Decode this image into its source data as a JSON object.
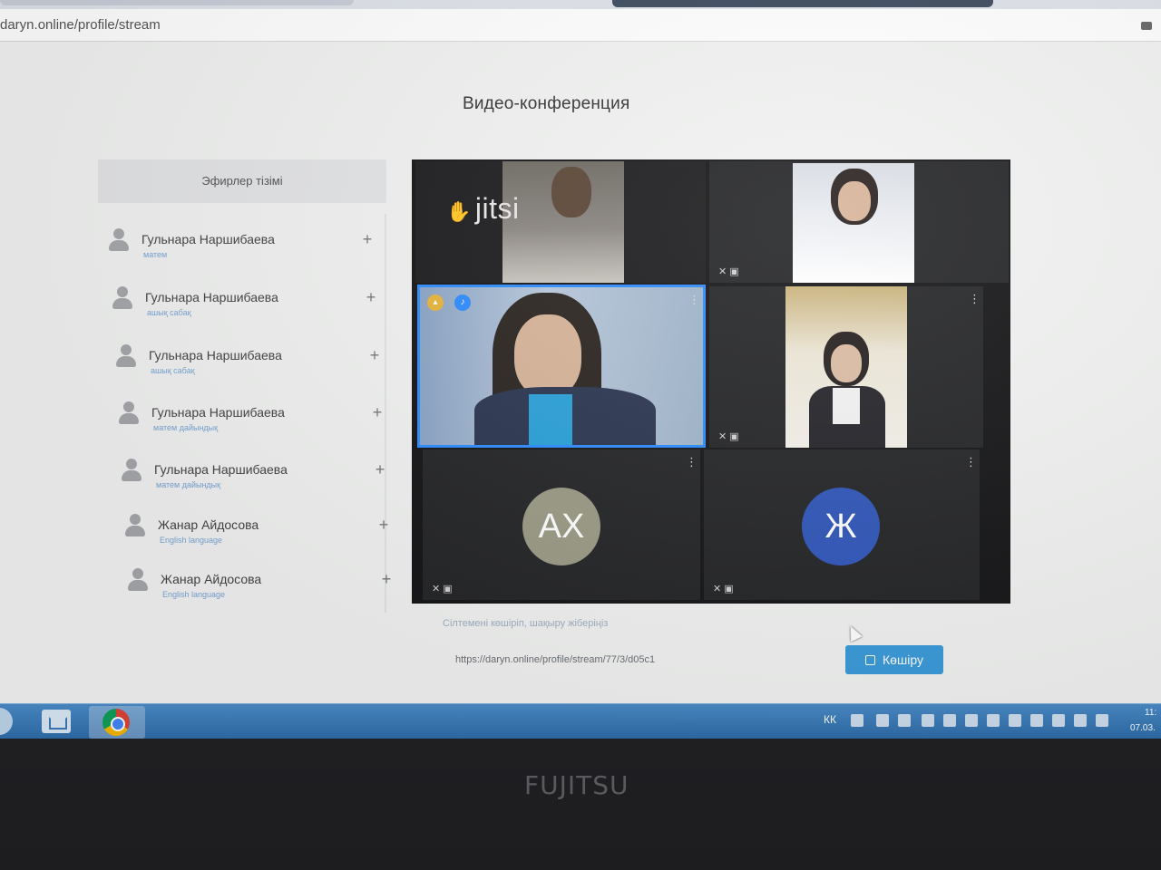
{
  "browser": {
    "url": "daryn.online/profile/stream"
  },
  "page": {
    "title": "Видео-конференция"
  },
  "sidebar": {
    "header": "Эфирлер тізімі",
    "items": [
      {
        "name": "Гульнара Наршибаева",
        "subject": "матем"
      },
      {
        "name": "Гульнара Наршибаева",
        "subject": "ашық сабақ"
      },
      {
        "name": "Гульнара Наршибаева",
        "subject": "ашық сабақ"
      },
      {
        "name": "Гульнара Наршибаева",
        "subject": "матем дайындық"
      },
      {
        "name": "Гульнара Наршибаева",
        "subject": "матем дайындық"
      },
      {
        "name": "Жанар Айдосова",
        "subject": "English language"
      },
      {
        "name": "Жанар Айдосова",
        "subject": "English language"
      }
    ],
    "add_symbol": "+"
  },
  "conference": {
    "logo_text": "jitsi",
    "menu_symbol": "⋮",
    "status_symbols": "✕ ▣",
    "participants": [
      {
        "initials": "AX",
        "color": "#9a9a85"
      },
      {
        "initials": "Ж",
        "color": "#2f56b8"
      }
    ]
  },
  "share": {
    "hint": "Сілтемені көшіріп, шақыру жіберіңіз",
    "link": "https://daryn.online/profile/stream/77/3/d05c1",
    "copy_label": "Көшіру"
  },
  "taskbar": {
    "language": "КК",
    "time": "11:",
    "date": "07.03."
  },
  "device": {
    "brand": "FUJITSU"
  }
}
